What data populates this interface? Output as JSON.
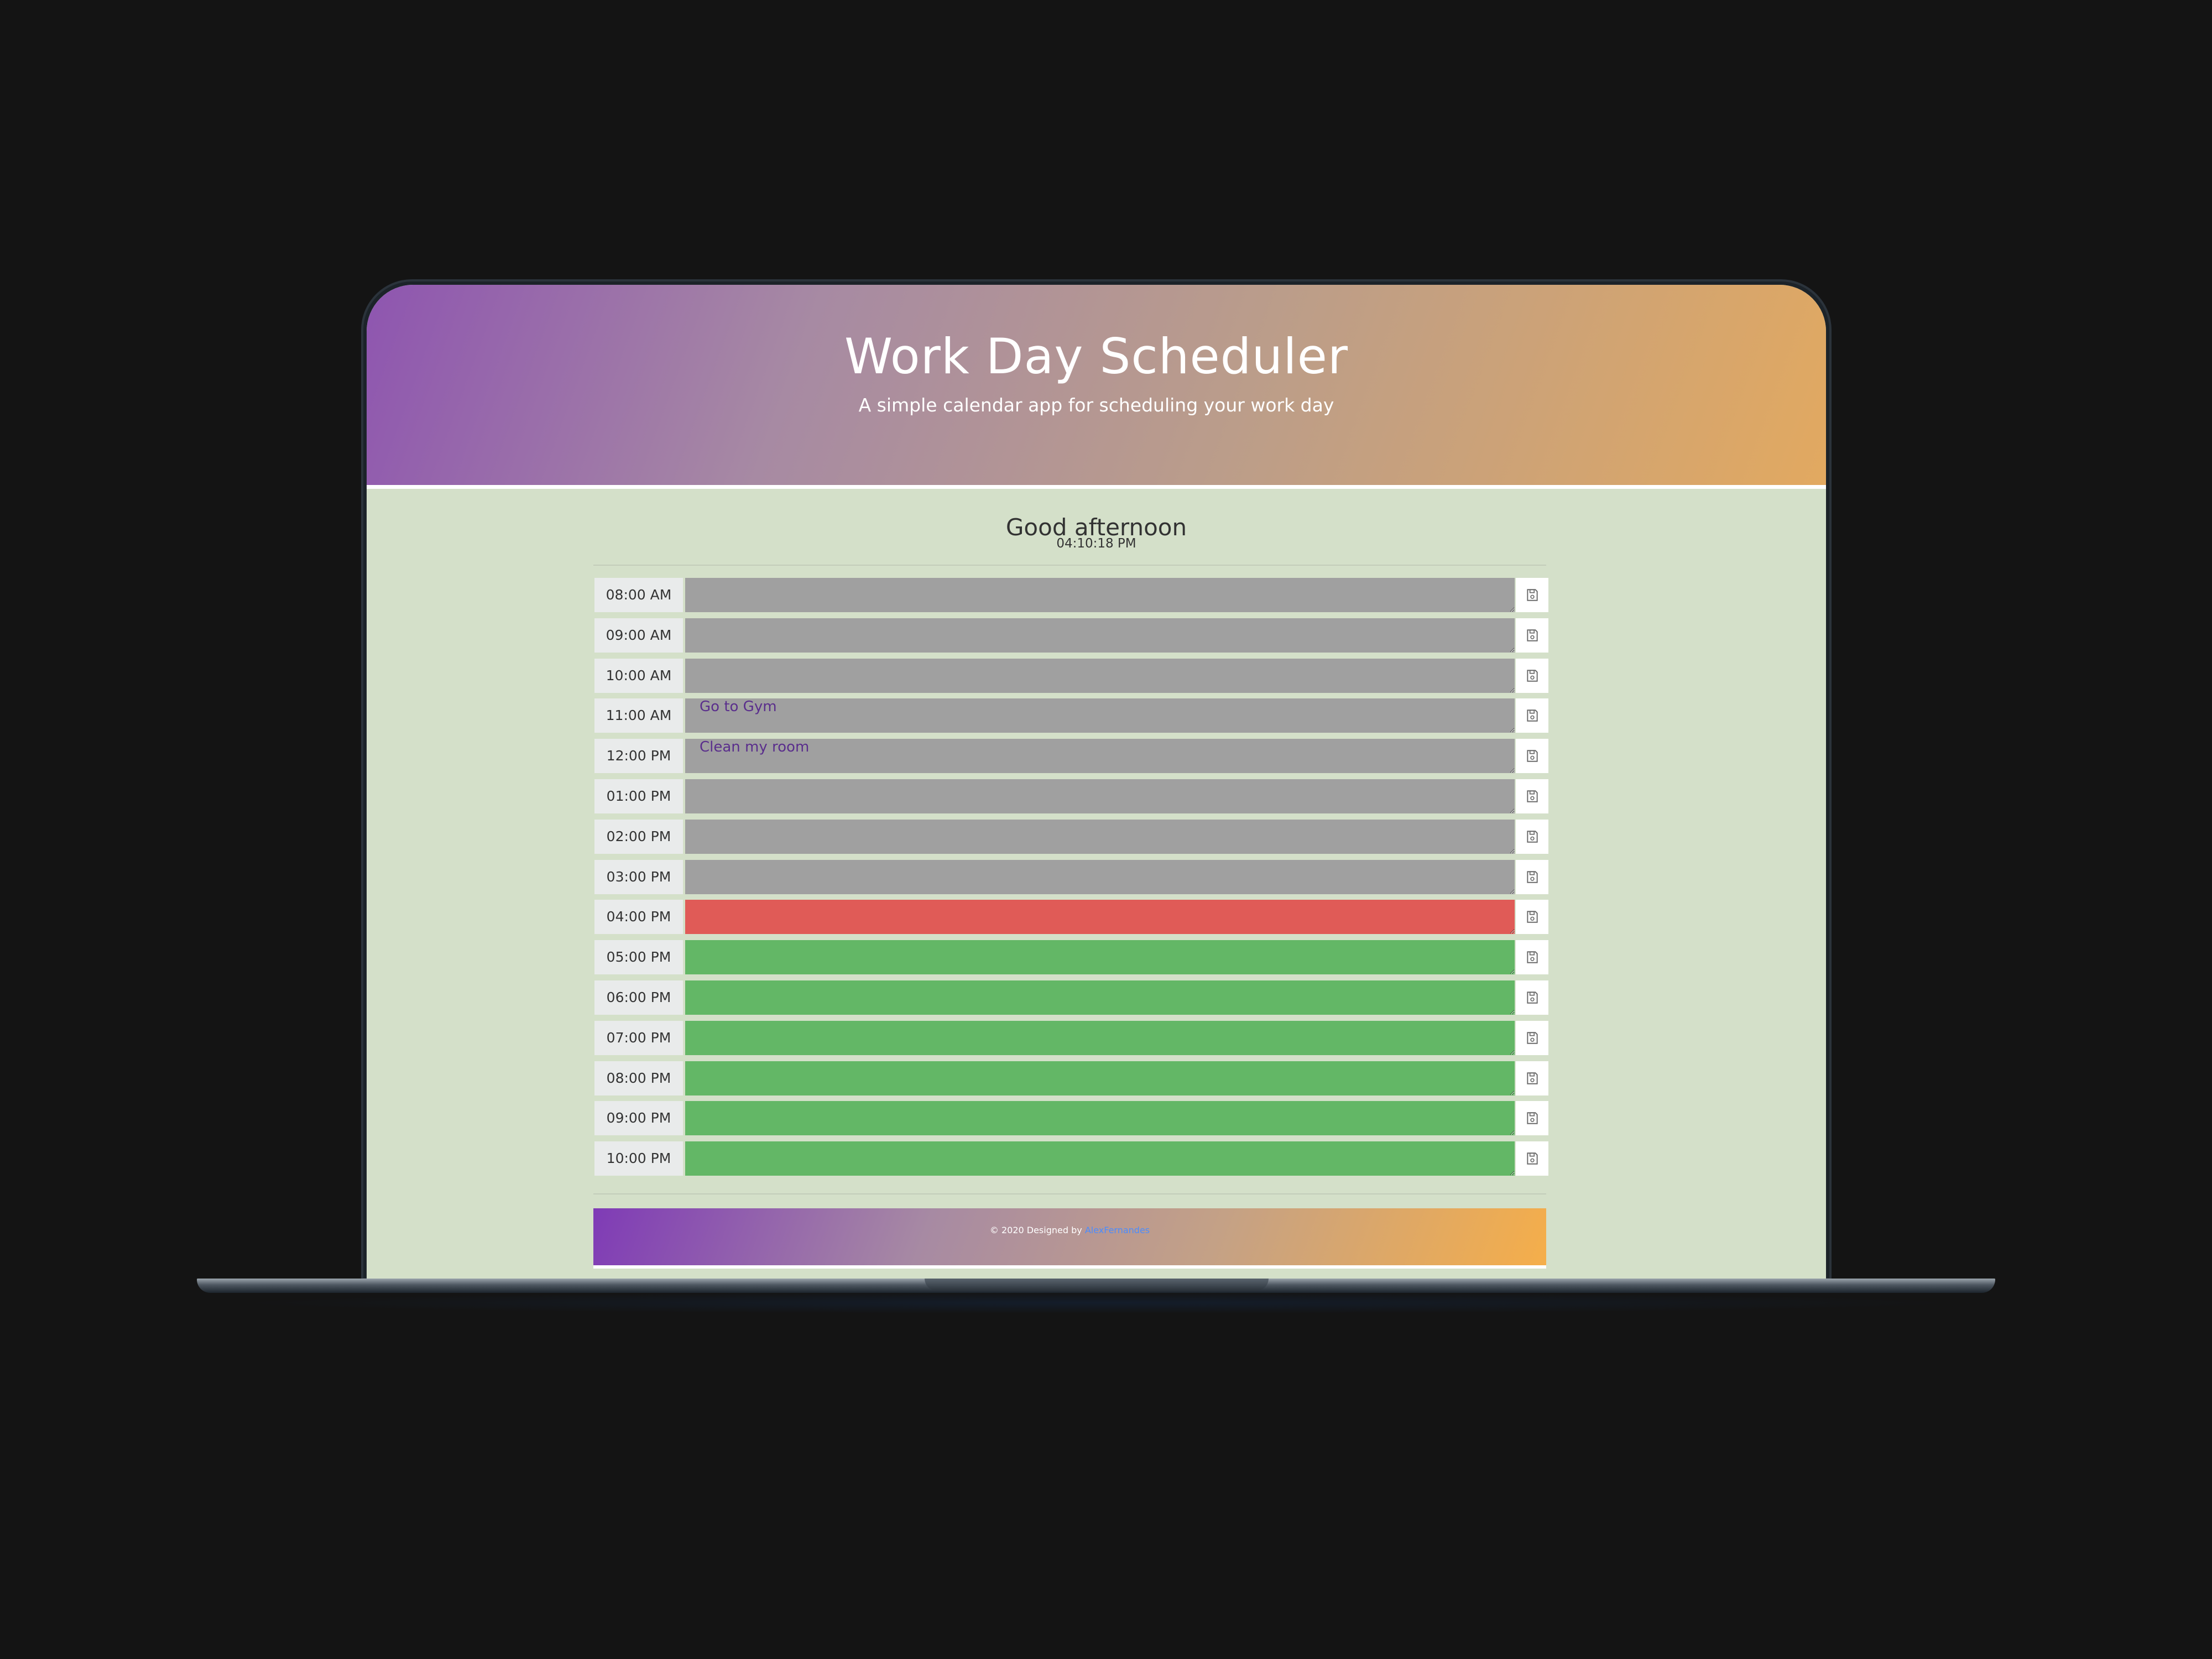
{
  "header": {
    "title": "Work Day Scheduler",
    "subtitle": "A simple calendar app for scheduling your work day"
  },
  "status": {
    "greeting": "Good afternoon",
    "time": "04:10:18 PM"
  },
  "schedule": [
    {
      "hour": "08:00 AM",
      "task": "",
      "state": "past"
    },
    {
      "hour": "09:00 AM",
      "task": "",
      "state": "past"
    },
    {
      "hour": "10:00 AM",
      "task": "",
      "state": "past"
    },
    {
      "hour": "11:00 AM",
      "task": "Go to Gym",
      "state": "past"
    },
    {
      "hour": "12:00 PM",
      "task": "Clean my room",
      "state": "past"
    },
    {
      "hour": "01:00 PM",
      "task": "",
      "state": "past"
    },
    {
      "hour": "02:00 PM",
      "task": "",
      "state": "past"
    },
    {
      "hour": "03:00 PM",
      "task": "",
      "state": "past"
    },
    {
      "hour": "04:00 PM",
      "task": "",
      "state": "present"
    },
    {
      "hour": "05:00 PM",
      "task": "",
      "state": "future"
    },
    {
      "hour": "06:00 PM",
      "task": "",
      "state": "future"
    },
    {
      "hour": "07:00 PM",
      "task": "",
      "state": "future"
    },
    {
      "hour": "08:00 PM",
      "task": "",
      "state": "future"
    },
    {
      "hour": "09:00 PM",
      "task": "",
      "state": "future"
    },
    {
      "hour": "10:00 PM",
      "task": "",
      "state": "future"
    }
  ],
  "footer": {
    "prefix": "© 2020 Designed by",
    "author": "AlexFernandes"
  },
  "icons": {
    "save": "save-icon"
  },
  "colors": {
    "past": "#a0a0a0",
    "present": "#e05b57",
    "future": "#63b766",
    "background": "#d4e0c9",
    "task_text": "#5a2e8c",
    "link": "#4a8cff"
  }
}
